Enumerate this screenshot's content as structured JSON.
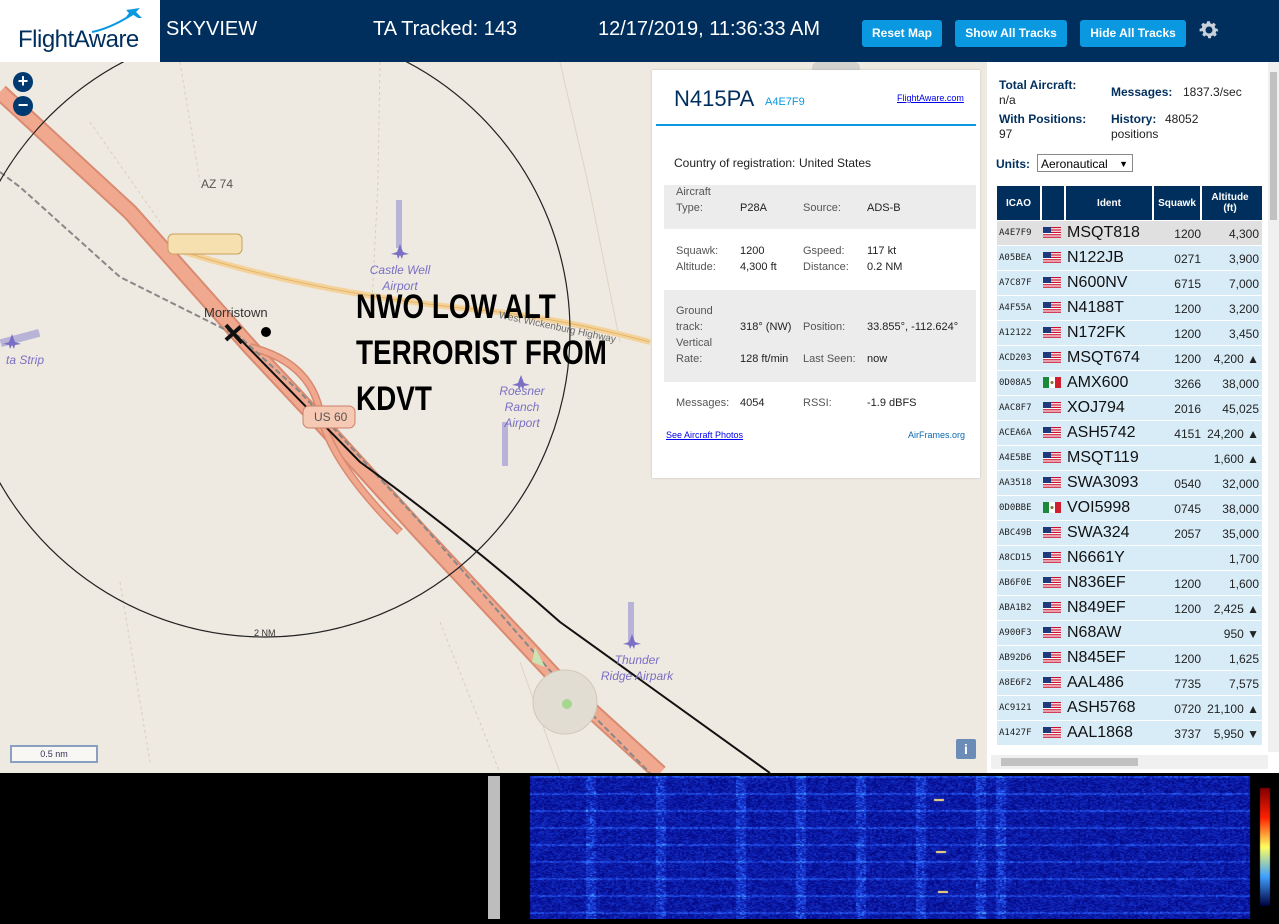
{
  "header": {
    "logo": "FlightAware",
    "app_title": "SKYVIEW",
    "tracked_label": "TA Tracked: 143",
    "datetime": "12/17/2019, 11:36:33 AM",
    "buttons": {
      "reset": "Reset Map",
      "show_all": "Show All Tracks",
      "hide_all": "Hide All Tracks"
    },
    "accent": "#0a98e0",
    "bg": "#002f5d"
  },
  "map": {
    "zoom_in": "+",
    "zoom_out": "−",
    "overlay_lines": [
      "NWO LOW ALT",
      "TERRORIST FROM",
      "KDVT"
    ],
    "labels": {
      "az74": "AZ 74",
      "us60": "US 60",
      "morristown": "Morristown",
      "highway": "West Wickenburg Highway",
      "castle_well": "Castle Well\nAirport",
      "roesner": "Roesner\nRanch\nAirport",
      "thunder": "Thunder\nRidge Airpark",
      "strip": "ta Strip",
      "range_ring": "2 NM"
    },
    "scale": "0.5 nm",
    "info": "i"
  },
  "selected": {
    "registration": "N415PA",
    "hex": "A4E7F9",
    "fa_link": "FlightAware.com",
    "country_label": "Country of registration:",
    "country": "United States",
    "aircraft_type_label1": "Aircraft",
    "aircraft_type_label2": "Type:",
    "aircraft_type": "P28A",
    "source_label": "Source:",
    "source": "ADS-B",
    "squawk_label": "Squawk:",
    "squawk": "1200",
    "gspeed_label": "Gspeed:",
    "gspeed": "117 kt",
    "altitude_label": "Altitude:",
    "altitude": "4,300 ft",
    "distance_label": "Distance:",
    "distance": "0.2 NM",
    "track_label1": "Ground",
    "track_label2": "track:",
    "track": "318° (NW)",
    "position_label": "Position:",
    "position": "33.855°, -112.624°",
    "vrate_label1": "Vertical",
    "vrate_label2": "Rate:",
    "vrate": "128 ft/min",
    "lastseen_label": "Last Seen:",
    "lastseen": "now",
    "messages_label": "Messages:",
    "messages": "4054",
    "rssi_label": "RSSI:",
    "rssi": "-1.9 dBFS",
    "photos_link": "See Aircraft Photos",
    "airframes_link": "AirFrames.org"
  },
  "panel": {
    "total_label": "Total Aircraft:",
    "total": "n/a",
    "messages_label": "Messages:",
    "messages": "1837.3/sec",
    "with_pos_label": "With Positions:",
    "with_pos": "97",
    "history_label": "History:",
    "history": "48052 positions",
    "units_label": "Units:",
    "units": "Aeronautical",
    "columns": [
      "ICAO",
      "Ident",
      "Squawk",
      "Altitude (ft)"
    ],
    "rows": [
      {
        "icao": "A4E7F9",
        "flag": "us",
        "ident": "MSQT818",
        "squawk": "1200",
        "alt": "4,300",
        "sel": true
      },
      {
        "icao": "A05BEA",
        "flag": "us",
        "ident": "N122JB",
        "squawk": "0271",
        "alt": "3,900"
      },
      {
        "icao": "A7C87F",
        "flag": "us",
        "ident": "N600NV",
        "squawk": "6715",
        "alt": "7,000"
      },
      {
        "icao": "A4F55A",
        "flag": "us",
        "ident": "N4188T",
        "squawk": "1200",
        "alt": "3,200"
      },
      {
        "icao": "A12122",
        "flag": "us",
        "ident": "N172FK",
        "squawk": "1200",
        "alt": "3,450"
      },
      {
        "icao": "ACD203",
        "flag": "us",
        "ident": "MSQT674",
        "squawk": "1200",
        "alt": "4,200 ▲"
      },
      {
        "icao": "0D08A5",
        "flag": "mx",
        "ident": "AMX600",
        "squawk": "3266",
        "alt": "38,000"
      },
      {
        "icao": "AAC8F7",
        "flag": "us",
        "ident": "XOJ794",
        "squawk": "2016",
        "alt": "45,025"
      },
      {
        "icao": "ACEA6A",
        "flag": "us",
        "ident": "ASH5742",
        "squawk": "4151",
        "alt": "24,200 ▲"
      },
      {
        "icao": "A4E5BE",
        "flag": "us",
        "ident": "MSQT119",
        "squawk": "",
        "alt": "1,600 ▲"
      },
      {
        "icao": "AA3518",
        "flag": "us",
        "ident": "SWA3093",
        "squawk": "0540",
        "alt": "32,000"
      },
      {
        "icao": "0D0BBE",
        "flag": "mx",
        "ident": "VOI5998",
        "squawk": "0745",
        "alt": "38,000"
      },
      {
        "icao": "ABC49B",
        "flag": "us",
        "ident": "SWA324",
        "squawk": "2057",
        "alt": "35,000"
      },
      {
        "icao": "A8CD15",
        "flag": "us",
        "ident": "N6661Y",
        "squawk": "",
        "alt": "1,700"
      },
      {
        "icao": "AB6F0E",
        "flag": "us",
        "ident": "N836EF",
        "squawk": "1200",
        "alt": "1,600"
      },
      {
        "icao": "ABA1B2",
        "flag": "us",
        "ident": "N849EF",
        "squawk": "1200",
        "alt": "2,425 ▲"
      },
      {
        "icao": "A900F3",
        "flag": "us",
        "ident": "N68AW",
        "squawk": "",
        "alt": "950 ▼"
      },
      {
        "icao": "AB92D6",
        "flag": "us",
        "ident": "N845EF",
        "squawk": "1200",
        "alt": "1,625"
      },
      {
        "icao": "A8E6F2",
        "flag": "us",
        "ident": "AAL486",
        "squawk": "7735",
        "alt": "7,575"
      },
      {
        "icao": "AC9121",
        "flag": "us",
        "ident": "ASH5768",
        "squawk": "0720",
        "alt": "21,100 ▲"
      },
      {
        "icao": "A1427F",
        "flag": "us",
        "ident": "AAL1868",
        "squawk": "3737",
        "alt": "5,950 ▼"
      }
    ]
  }
}
